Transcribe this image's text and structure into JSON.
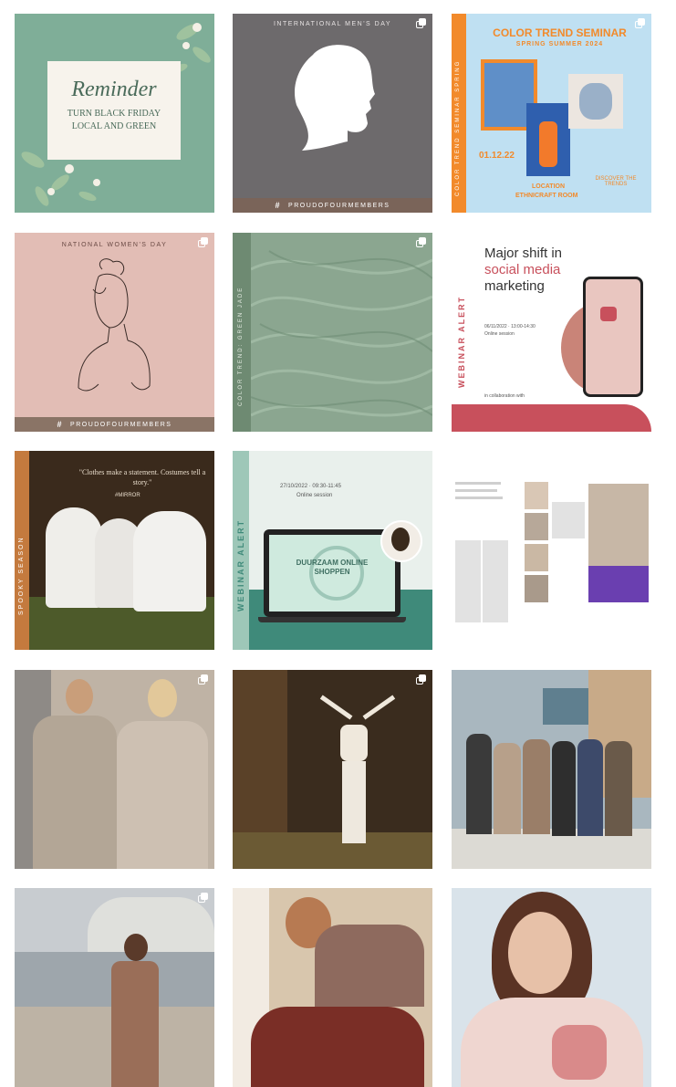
{
  "posts": [
    {
      "script": "Reminder",
      "caption": "TURN BLACK FRIDAY LOCAL AND GREEN",
      "bg": "#7fae98"
    },
    {
      "title": "INTERNATIONAL MEN'S DAY",
      "hashtag": "#",
      "footer": "PROUDOFOURMEMBERS",
      "bg": "#6d6a6c"
    },
    {
      "title": "COLOR TREND SEMINAR",
      "subtitle": "SPRING SUMMER 2024",
      "side": "COLOR TREND SEMINAR SPRING",
      "date": "01.12.22",
      "location_label": "LOCATION",
      "location": "ETHNICRAFT ROOM",
      "note": "DISCOVER THE TRENDS",
      "bg": "#bfe0f2",
      "accent": "#f28a2b"
    },
    {
      "title": "NATIONAL WOMEN'S DAY",
      "hashtag": "#",
      "footer": "PROUDOFOURMEMBERS",
      "bg": "#e2bdb5"
    },
    {
      "side": "COLOR TREND: GREEN JADE",
      "bg": "#8ba690"
    },
    {
      "line1": "Major shift in",
      "line2": "social media",
      "line3": "marketing",
      "side": "WEBINAR ALERT",
      "detail": "06/11/2022 · 13:00-14:30",
      "detail2": "Online session",
      "footer": "in collaboration with",
      "accent": "#c8505c"
    },
    {
      "quote": "\"Clothes make a statement. Costumes tell a story.\"",
      "author": "#MIRROR",
      "side": "SPOOKY SEASON",
      "bg": "#3a2a1c"
    },
    {
      "date": "27/10/2022 · 09:30-11:45",
      "detail": "Online session",
      "side": "WEBINAR ALERT",
      "screen": "DUURZAAM ONLINE SHOPPEN",
      "bg": "#e9f0ec",
      "accent": "#3f8a7a"
    },
    {
      "bg": "#ffffff"
    },
    {
      "bg": "#bfb3a5"
    },
    {
      "bg": "#3a2c1e"
    },
    {
      "bg": "#a9b7bf"
    },
    {
      "bg": "#c8ccd0"
    },
    {
      "bg": "#d8c6ad"
    },
    {
      "bg": "#e8d8cc"
    }
  ]
}
